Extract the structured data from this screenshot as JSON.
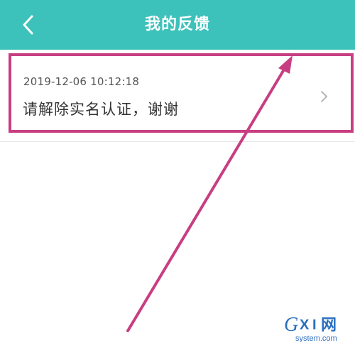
{
  "header": {
    "title": "我的反馈",
    "back_icon": "chevron-left-icon"
  },
  "feedback_list": [
    {
      "time": "2019-12-06 10:12:18",
      "content": "请解除实名认证，谢谢",
      "chevron_icon": "chevron-right-icon"
    }
  ],
  "annotation": {
    "color": "#c83e82"
  },
  "watermark": {
    "brand": "GXI网",
    "domain": "system.com"
  },
  "colors": {
    "header_bg": "#3dc1bb",
    "header_text": "#ffffff",
    "time_text": "#555555",
    "content_text": "#333333"
  }
}
